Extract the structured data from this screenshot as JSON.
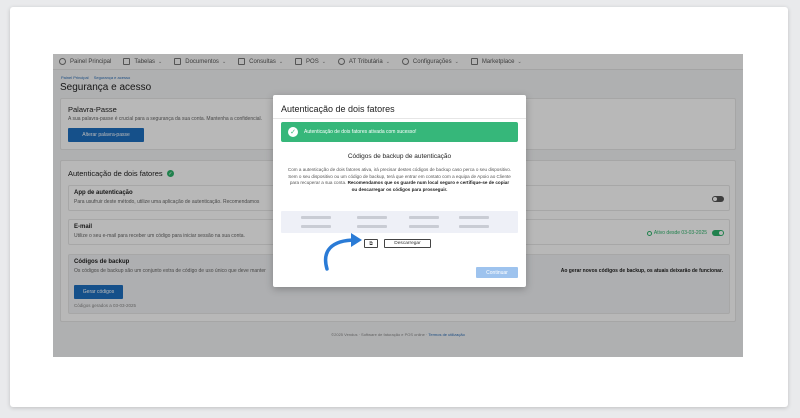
{
  "nav": {
    "items": [
      {
        "label": "Painel Principal",
        "icon": "dashboard-icon",
        "chevron": false
      },
      {
        "label": "Tabelas",
        "icon": "table-icon",
        "chevron": true
      },
      {
        "label": "Documentos",
        "icon": "document-icon",
        "chevron": true
      },
      {
        "label": "Consultas",
        "icon": "search-doc-icon",
        "chevron": true
      },
      {
        "label": "POS",
        "icon": "pos-icon",
        "chevron": true
      },
      {
        "label": "AT Tributária",
        "icon": "tax-icon",
        "chevron": true
      },
      {
        "label": "Configurações",
        "icon": "gear-icon",
        "chevron": true
      },
      {
        "label": "Marketplace",
        "icon": "marketplace-icon",
        "chevron": true
      }
    ],
    "chevron_glyph": "⌄"
  },
  "breadcrumb": {
    "items": [
      "Painel Principal",
      "Segurança e acesso"
    ]
  },
  "page": {
    "title": "Segurança e acesso"
  },
  "password_panel": {
    "title": "Palavra-Passe",
    "description": "A sua palavra-passe é crucial para a segurança da sua conta. Mantenha a confidencial.",
    "button": "Alterar palavra-passe"
  },
  "twofa_panel": {
    "title": "Autenticação de dois fatores",
    "check_glyph": "✓",
    "app": {
      "title": "App de autenticação",
      "description": "Para usufruir deste método, utilize uma aplicação de autenticação. Recomendamos"
    },
    "email": {
      "title": "E-mail",
      "description": "Utilize o seu e-mail para receber um código para iniciar sessão na sua conta.",
      "status": "Ativo desde 03-03-2025",
      "status_color": "#2db36b"
    },
    "backup": {
      "title": "Códigos de backup",
      "description": "Os códigos de backup são um conjunto extra de código de uso único que deve manter",
      "warning": "Ao gerar novos códigos de backup, os atuais deixarão de funcionar.",
      "button": "Gerar códigos",
      "generated": "Códigos gerados a 03-03-2025"
    }
  },
  "footer": {
    "text": "©2025 Vendus · Software de faturação e POS online ·",
    "link": "Termos de utilização"
  },
  "modal": {
    "title": "Autenticação de dois fatores",
    "alert": {
      "text": "Autenticação de dois fatores ativada com sucesso!",
      "color": "#36b77a",
      "icon_glyph": "✓"
    },
    "codes_title": "Códigos de backup de autenticação",
    "codes_desc": "Com a autenticação de dois fatores ativa, irá precisar destes códigos de backup caso perca o seu dispositivo. Sem o seu dispositivo ou um código de backup, terá que entrar em contato com a equipa de Apoio ao Cliente para recuperar a sua conta.",
    "codes_desc_bold": "Recomendamos que os guarde num local seguro e certifique-se de copiar ou descarregar os códigos para prosseguir.",
    "copy_glyph": "⧉",
    "download_button": "Descarregar",
    "continue_button": "Continuar",
    "continue_color": "#9ec3ee"
  },
  "colors": {
    "accent": "#1e6fbf",
    "arrow": "#2a7bd6",
    "success": "#36b77a"
  }
}
